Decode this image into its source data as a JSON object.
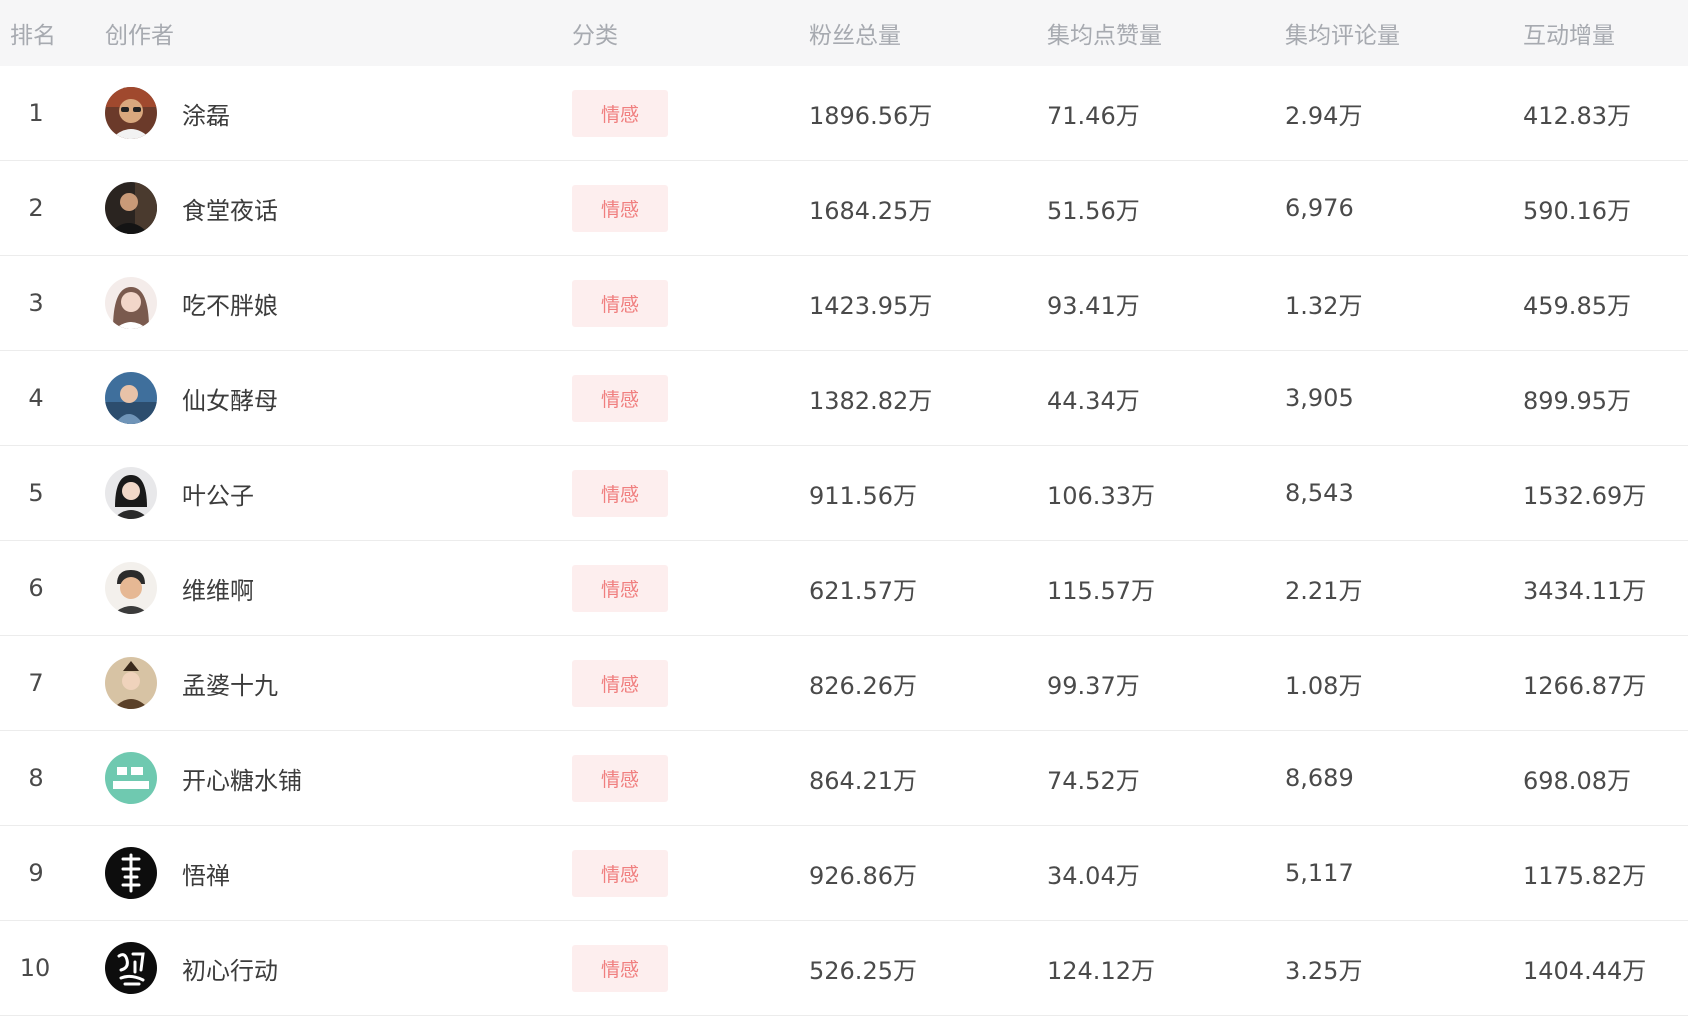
{
  "header": {
    "rank": "排名",
    "creator": "创作者",
    "category": "分类",
    "fans": "粉丝总量",
    "avg_likes": "集均点赞量",
    "avg_comments": "集均评论量",
    "interaction_growth": "互动增量"
  },
  "colors": {
    "header_bg": "#f6f6f7",
    "tag_bg": "#fdeeee",
    "tag_text": "#f07f7f",
    "divider": "#ececec"
  },
  "rows": [
    {
      "rank": "1",
      "name": "涂磊",
      "avatar_icon": "portrait-man-glasses-icon",
      "category": "情感",
      "fans": "1896.56万",
      "avg_likes": "71.46万",
      "avg_comments": "2.94万",
      "interaction_growth": "412.83万"
    },
    {
      "rank": "2",
      "name": "食堂夜话",
      "avatar_icon": "portrait-man-dark-icon",
      "category": "情感",
      "fans": "1684.25万",
      "avg_likes": "51.56万",
      "avg_comments": "6,976",
      "interaction_growth": "590.16万"
    },
    {
      "rank": "3",
      "name": "吃不胖娘",
      "avatar_icon": "portrait-woman-light-icon",
      "category": "情感",
      "fans": "1423.95万",
      "avg_likes": "93.41万",
      "avg_comments": "1.32万",
      "interaction_growth": "459.85万"
    },
    {
      "rank": "4",
      "name": "仙女酵母",
      "avatar_icon": "portrait-woman-blue-icon",
      "category": "情感",
      "fans": "1382.82万",
      "avg_likes": "44.34万",
      "avg_comments": "3,905",
      "interaction_growth": "899.95万"
    },
    {
      "rank": "5",
      "name": "叶公子",
      "avatar_icon": "portrait-woman-white-icon",
      "category": "情感",
      "fans": "911.56万",
      "avg_likes": "106.33万",
      "avg_comments": "8,543",
      "interaction_growth": "1532.69万"
    },
    {
      "rank": "6",
      "name": "维维啊",
      "avatar_icon": "portrait-man-smiling-icon",
      "category": "情感",
      "fans": "621.57万",
      "avg_likes": "115.57万",
      "avg_comments": "2.21万",
      "interaction_growth": "3434.11万"
    },
    {
      "rank": "7",
      "name": "孟婆十九",
      "avatar_icon": "portrait-woman-costume-icon",
      "category": "情感",
      "fans": "826.26万",
      "avg_likes": "99.37万",
      "avg_comments": "1.08万",
      "interaction_growth": "1266.87万"
    },
    {
      "rank": "8",
      "name": "开心糖水铺",
      "avatar_icon": "text-logo-green-icon",
      "category": "情感",
      "fans": "864.21万",
      "avg_likes": "74.52万",
      "avg_comments": "8,689",
      "interaction_growth": "698.08万"
    },
    {
      "rank": "9",
      "name": "悟禅",
      "avatar_icon": "calligraphy-logo-black-icon",
      "category": "情感",
      "fans": "926.86万",
      "avg_likes": "34.04万",
      "avg_comments": "5,117",
      "interaction_growth": "1175.82万"
    },
    {
      "rank": "10",
      "name": "初心行动",
      "avatar_icon": "calligraphy-logo-black-icon",
      "category": "情感",
      "fans": "526.25万",
      "avg_likes": "124.12万",
      "avg_comments": "3.25万",
      "interaction_growth": "1404.44万"
    }
  ]
}
